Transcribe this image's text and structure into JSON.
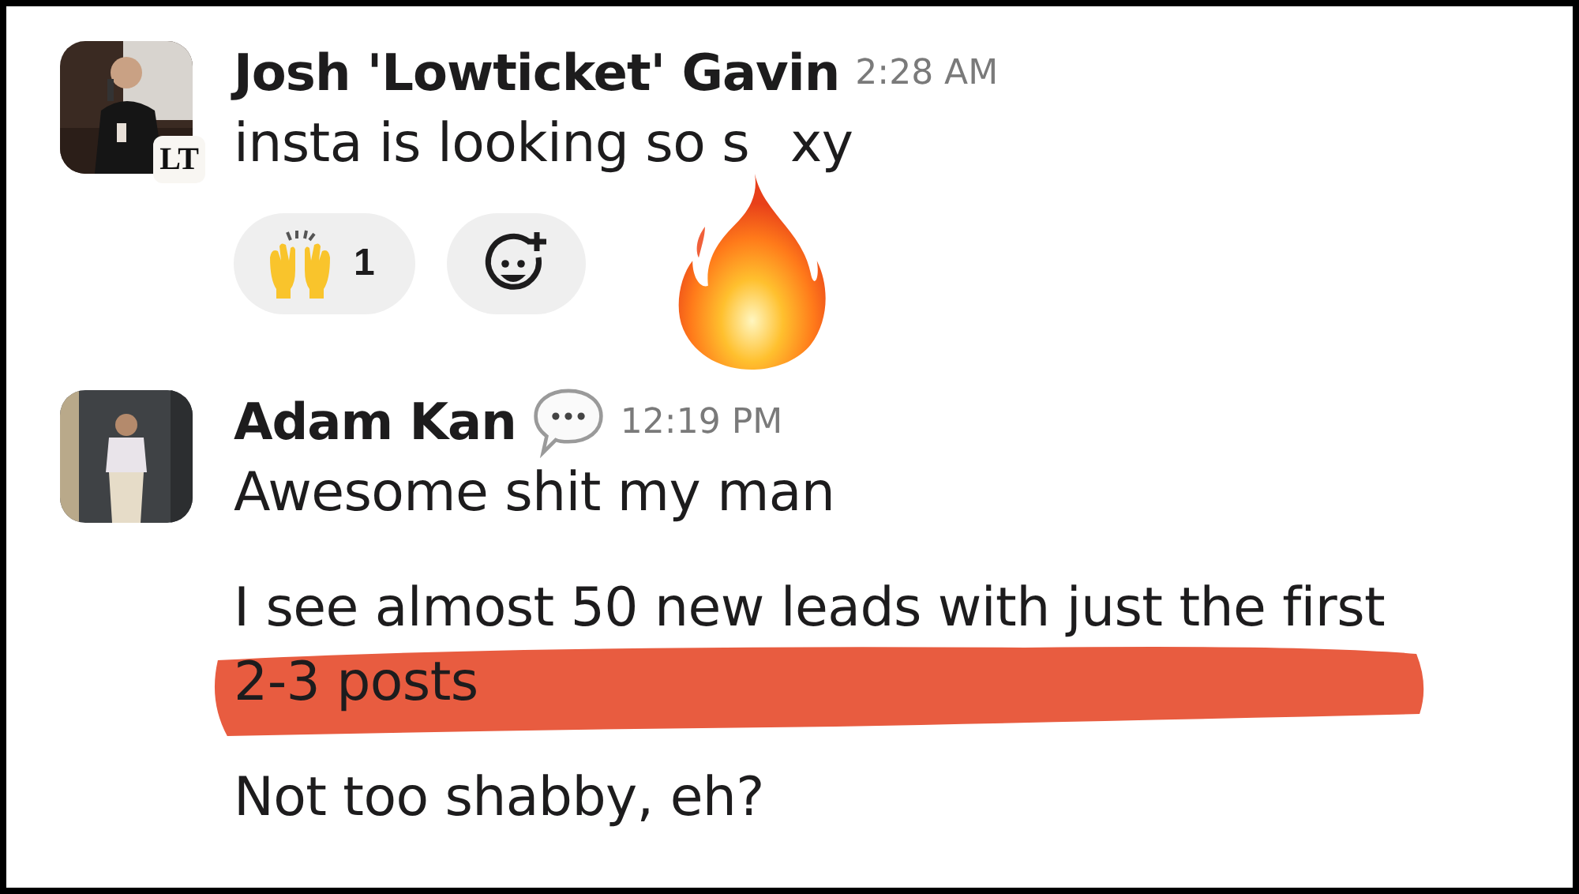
{
  "messages": [
    {
      "author": "Josh 'Lowticket' Gavin",
      "time": "2:28 AM",
      "avatar_badge": "LT",
      "text_parts": [
        "insta is looking so s",
        "xy"
      ],
      "fire_sticker": true,
      "reactions": [
        {
          "kind": "emoji",
          "count": "1"
        },
        {
          "kind": "add"
        }
      ]
    },
    {
      "author": "Adam Kan",
      "time": "12:19 PM",
      "status_icon": true,
      "paragraphs": [
        {
          "lines": [
            "Awesome shit my man"
          ],
          "highlighted": false
        },
        {
          "lines": [
            "I see almost 50 new leads with just the first",
            "2-3 posts"
          ],
          "highlighted": true
        },
        {
          "lines": [
            "Not too shabby, eh?"
          ],
          "highlighted": false
        }
      ]
    }
  ]
}
